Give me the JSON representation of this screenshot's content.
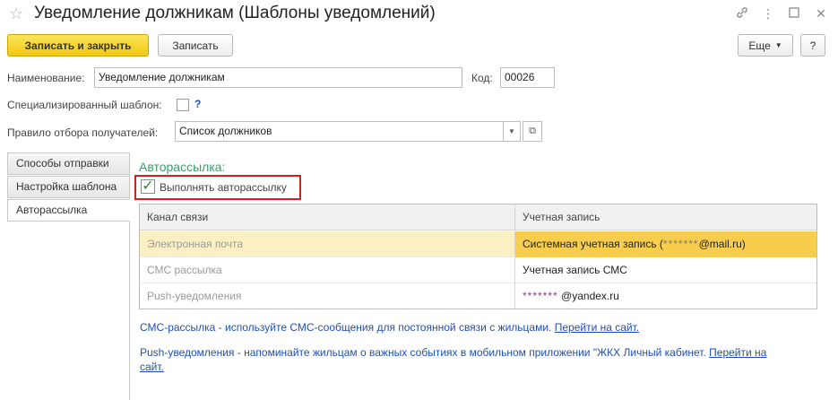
{
  "window": {
    "title": "Уведомление должникам (Шаблоны уведомлений)"
  },
  "toolbar": {
    "save_close": "Записать и закрыть",
    "save": "Записать",
    "more": "Еще",
    "help": "?"
  },
  "form": {
    "name_label": "Наименование:",
    "name_value": "Уведомление должникам",
    "code_label": "Код:",
    "code_value": "00026",
    "specialized_label": "Специализированный шаблон:",
    "specialized_help": "?",
    "rule_label": "Правило отбора получателей:",
    "rule_value": "Список должников"
  },
  "tabs": [
    {
      "label": "Способы отправки",
      "active": false
    },
    {
      "label": "Настройка шаблона",
      "active": false
    },
    {
      "label": "Авторассылка",
      "active": true
    }
  ],
  "autosend": {
    "group_title": "Авторассылка:",
    "enable_label": "Выполнять авторассылку",
    "enabled": true,
    "columns": [
      "Канал связи",
      "Учетная запись"
    ],
    "rows": [
      {
        "channel": "Электронная почта",
        "account_prefix": "Системная учетная запись (",
        "account_mask": "*******",
        "account_suffix": "@mail.ru)",
        "selected": true
      },
      {
        "channel": "СМС рассылка",
        "account_prefix": "Учетная запись СМС",
        "account_mask": "",
        "account_suffix": "",
        "selected": false
      },
      {
        "channel": "Push-уведомления",
        "account_prefix": "",
        "account_mask": "*******",
        "account_suffix": " @yandex.ru",
        "selected": false
      }
    ]
  },
  "info": {
    "sms_text": "СМС-рассылка - используйте СМС-сообщения для постоянной связи с жильцами. ",
    "sms_link": "Перейти на сайт.",
    "push_text": "Push-уведомления - напоминайте жильцам о важных событиях в мобильном приложении \"ЖКХ Личный кабинет. ",
    "push_link_1": "Перейти на",
    "push_link_2": "сайт."
  },
  "colors": {
    "primary_button": "#f2c811",
    "selected_row": "#fbf0c4",
    "highlight_border": "#e01b1b",
    "group_title": "#3aa06a",
    "link": "#1f4fb5"
  }
}
